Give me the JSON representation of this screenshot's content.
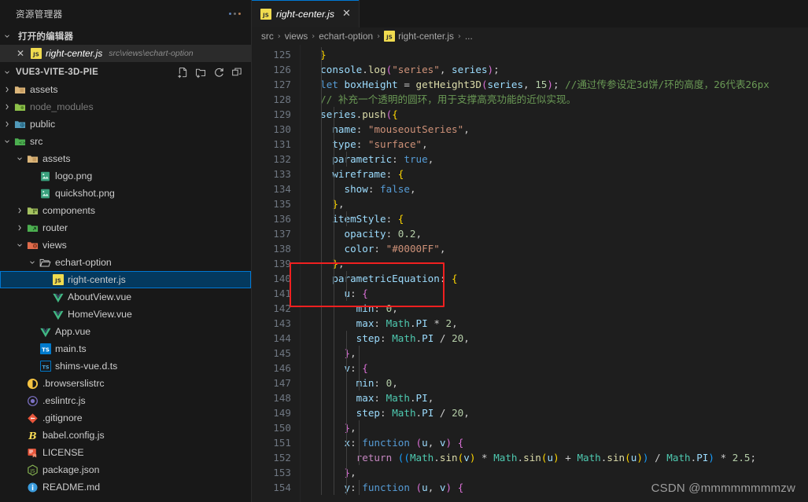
{
  "sidebar": {
    "title": "资源管理器",
    "more_icon": "more-dots-icon",
    "open_editors": {
      "label": "打开的编辑器",
      "chevron": "⌄",
      "items": [
        {
          "name": "right-center.js",
          "path": "src\\views\\echart-option",
          "icon": "js-file-icon",
          "close": "✕"
        }
      ]
    },
    "project": {
      "label": "VUE3-VITE-3D-PIE",
      "chevron": "⌄",
      "actions": [
        {
          "name": "new-file-icon",
          "title": "New File"
        },
        {
          "name": "new-folder-icon",
          "title": "New Folder"
        },
        {
          "name": "refresh-icon",
          "title": "Refresh Explorer"
        },
        {
          "name": "collapse-all-icon",
          "title": "Collapse Folders"
        }
      ]
    },
    "tree": [
      {
        "label": "assets",
        "indent": 1,
        "type": "folder",
        "chevron": "›",
        "icon": "folder-assets-icon",
        "selected": false,
        "dim": false
      },
      {
        "label": "node_modules",
        "indent": 1,
        "type": "folder",
        "chevron": "›",
        "icon": "folder-node-icon",
        "selected": false,
        "dim": true
      },
      {
        "label": "public",
        "indent": 1,
        "type": "folder",
        "chevron": "›",
        "icon": "folder-public-icon",
        "selected": false,
        "dim": false
      },
      {
        "label": "src",
        "indent": 1,
        "type": "folder",
        "chevron": "⌄",
        "icon": "folder-src-icon",
        "selected": false,
        "dim": false
      },
      {
        "label": "assets",
        "indent": 2,
        "type": "folder",
        "chevron": "⌄",
        "icon": "folder-assets-icon",
        "selected": false,
        "dim": false
      },
      {
        "label": "logo.png",
        "indent": 3,
        "type": "file",
        "chevron": "",
        "icon": "image-file-icon",
        "selected": false,
        "dim": false
      },
      {
        "label": "quickshot.png",
        "indent": 3,
        "type": "file",
        "chevron": "",
        "icon": "image-file-icon",
        "selected": false,
        "dim": false
      },
      {
        "label": "components",
        "indent": 2,
        "type": "folder",
        "chevron": "›",
        "icon": "folder-components-icon",
        "selected": false,
        "dim": false
      },
      {
        "label": "router",
        "indent": 2,
        "type": "folder",
        "chevron": "›",
        "icon": "folder-router-icon",
        "selected": false,
        "dim": false
      },
      {
        "label": "views",
        "indent": 2,
        "type": "folder",
        "chevron": "⌄",
        "icon": "folder-views-icon",
        "selected": false,
        "dim": false
      },
      {
        "label": "echart-option",
        "indent": 3,
        "type": "folder",
        "chevron": "⌄",
        "icon": "folder-open-icon",
        "selected": false,
        "dim": false
      },
      {
        "label": "right-center.js",
        "indent": 4,
        "type": "file",
        "chevron": "",
        "icon": "js-file-icon",
        "selected": true,
        "dim": false
      },
      {
        "label": "AboutView.vue",
        "indent": 4,
        "type": "file",
        "chevron": "",
        "icon": "vue-file-icon",
        "selected": false,
        "dim": false
      },
      {
        "label": "HomeView.vue",
        "indent": 4,
        "type": "file",
        "chevron": "",
        "icon": "vue-file-icon",
        "selected": false,
        "dim": false
      },
      {
        "label": "App.vue",
        "indent": 3,
        "type": "file",
        "chevron": "",
        "icon": "vue-file-icon",
        "selected": false,
        "dim": false
      },
      {
        "label": "main.ts",
        "indent": 3,
        "type": "file",
        "chevron": "",
        "icon": "ts-file-icon",
        "selected": false,
        "dim": false
      },
      {
        "label": "shims-vue.d.ts",
        "indent": 3,
        "type": "file",
        "chevron": "",
        "icon": "ts-def-file-icon",
        "selected": false,
        "dim": false
      },
      {
        "label": ".browserslistrc",
        "indent": 2,
        "type": "file",
        "chevron": "",
        "icon": "browserslist-icon",
        "selected": false,
        "dim": false
      },
      {
        "label": ".eslintrc.js",
        "indent": 2,
        "type": "file",
        "chevron": "",
        "icon": "eslint-icon",
        "selected": false,
        "dim": false
      },
      {
        "label": ".gitignore",
        "indent": 2,
        "type": "file",
        "chevron": "",
        "icon": "git-icon",
        "selected": false,
        "dim": false
      },
      {
        "label": "babel.config.js",
        "indent": 2,
        "type": "file",
        "chevron": "",
        "icon": "babel-icon",
        "selected": false,
        "dim": false
      },
      {
        "label": "LICENSE",
        "indent": 2,
        "type": "file",
        "chevron": "",
        "icon": "license-icon",
        "selected": false,
        "dim": false
      },
      {
        "label": "package.json",
        "indent": 2,
        "type": "file",
        "chevron": "",
        "icon": "npm-icon",
        "selected": false,
        "dim": false
      },
      {
        "label": "README.md",
        "indent": 2,
        "type": "file",
        "chevron": "",
        "icon": "readme-icon",
        "selected": false,
        "dim": false
      }
    ]
  },
  "editor": {
    "tab": {
      "label": "right-center.js",
      "icon": "js-file-icon",
      "close": "✕"
    },
    "breadcrumb": [
      {
        "label": "src",
        "icon": ""
      },
      {
        "label": "views",
        "icon": ""
      },
      {
        "label": "echart-option",
        "icon": ""
      },
      {
        "label": "right-center.js",
        "icon": "js-file-icon"
      },
      {
        "label": "...",
        "icon": ""
      }
    ],
    "breadcrumb_separator": "›",
    "first_line_number": 125,
    "line_count": 30,
    "watermark": "CSDN @mmmmmmmmzw",
    "highlight_box": {
      "color": "#f02020",
      "lines": [
        136,
        137,
        138
      ]
    },
    "code": [
      {
        "n": 125,
        "html": "  <span class='by'>}</span>"
      },
      {
        "n": 126,
        "html": "  <span class='v'>console</span><span class='p'>.</span><span class='f'>log</span><span class='bp'>(</span><span class='s'>\"series\"</span><span class='p'>, </span><span class='v'>series</span><span class='bp'>)</span><span class='p'>;</span>"
      },
      {
        "n": 127,
        "html": "  <span class='k'>let</span> <span class='v'>boxHeight</span> <span class='p'>=</span> <span class='f'>getHeight3D</span><span class='bp'>(</span><span class='v'>series</span><span class='p'>, </span><span class='n'>15</span><span class='bp'>)</span><span class='p'>;</span> <span class='c'>//通过传参设定3d饼/环的高度，26代表26px</span>"
      },
      {
        "n": 128,
        "html": "  <span class='c'>// 补充一个透明的圆环，用于支撑高亮功能的近似实现。</span>"
      },
      {
        "n": 129,
        "html": "  <span class='v'>series</span><span class='p'>.</span><span class='f'>push</span><span class='bp'>(</span><span class='by'>{</span>"
      },
      {
        "n": 130,
        "html": "    <span class='v'>name</span><span class='p'>:</span> <span class='s'>\"mouseoutSeries\"</span><span class='p'>,</span>"
      },
      {
        "n": 131,
        "html": "    <span class='v'>type</span><span class='p'>:</span> <span class='s'>\"surface\"</span><span class='p'>,</span>"
      },
      {
        "n": 132,
        "html": "    <span class='v'>parametric</span><span class='p'>:</span> <span class='k'>true</span><span class='p'>,</span>"
      },
      {
        "n": 133,
        "html": "    <span class='v'>wireframe</span><span class='p'>:</span> <span class='by'>{</span>"
      },
      {
        "n": 134,
        "html": "      <span class='v'>show</span><span class='p'>:</span> <span class='k'>false</span><span class='p'>,</span>"
      },
      {
        "n": 135,
        "html": "    <span class='by'>}</span><span class='p'>,</span>"
      },
      {
        "n": 136,
        "html": "    <span class='v'>itemStyle</span><span class='p'>:</span> <span class='by'>{</span>"
      },
      {
        "n": 137,
        "html": "      <span class='v'>opacity</span><span class='p'>:</span> <span class='n'>0.2</span><span class='p'>,</span>"
      },
      {
        "n": 138,
        "html": "      <span class='v'>color</span><span class='p'>:</span> <span class='s'>\"#0000FF\"</span><span class='p'>,</span>"
      },
      {
        "n": 139,
        "html": "    <span class='by'>}</span><span class='p'>,</span>"
      },
      {
        "n": 140,
        "html": "    <span class='v'>parametricEquation</span><span class='p'>:</span> <span class='by'>{</span>"
      },
      {
        "n": 141,
        "html": "      <span class='v'>u</span><span class='p'>:</span> <span class='bp'>{</span>"
      },
      {
        "n": 142,
        "html": "        <span class='v'>min</span><span class='p'>:</span> <span class='n'>0</span><span class='p'>,</span>"
      },
      {
        "n": 143,
        "html": "        <span class='v'>max</span><span class='p'>:</span> <span class='t'>Math</span><span class='p'>.</span><span class='v'>PI</span> <span class='p'>*</span> <span class='n'>2</span><span class='p'>,</span>"
      },
      {
        "n": 144,
        "html": "        <span class='v'>step</span><span class='p'>:</span> <span class='t'>Math</span><span class='p'>.</span><span class='v'>PI</span> <span class='p'>/</span> <span class='n'>20</span><span class='p'>,</span>"
      },
      {
        "n": 145,
        "html": "      <span class='bp'>}</span><span class='p'>,</span>"
      },
      {
        "n": 146,
        "html": "      <span class='v'>v</span><span class='p'>:</span> <span class='bp'>{</span>"
      },
      {
        "n": 147,
        "html": "        <span class='v'>min</span><span class='p'>:</span> <span class='n'>0</span><span class='p'>,</span>"
      },
      {
        "n": 148,
        "html": "        <span class='v'>max</span><span class='p'>:</span> <span class='t'>Math</span><span class='p'>.</span><span class='v'>PI</span><span class='p'>,</span>"
      },
      {
        "n": 149,
        "html": "        <span class='v'>step</span><span class='p'>:</span> <span class='t'>Math</span><span class='p'>.</span><span class='v'>PI</span> <span class='p'>/</span> <span class='n'>20</span><span class='p'>,</span>"
      },
      {
        "n": 150,
        "html": "      <span class='bp'>}</span><span class='p'>,</span>"
      },
      {
        "n": 151,
        "html": "      <span class='v'>x</span><span class='p'>:</span> <span class='k'>function</span> <span class='bp'>(</span><span class='v'>u</span><span class='p'>, </span><span class='v'>v</span><span class='bp'>)</span> <span class='bp'>{</span>"
      },
      {
        "n": 152,
        "html": "        <span class='kp'>return</span> <span class='bb'>((</span><span class='t'>Math</span><span class='p'>.</span><span class='f'>sin</span><span class='by'>(</span><span class='v'>v</span><span class='by'>)</span> <span class='p'>*</span> <span class='t'>Math</span><span class='p'>.</span><span class='f'>sin</span><span class='by'>(</span><span class='v'>u</span><span class='by'>)</span> <span class='p'>+</span> <span class='t'>Math</span><span class='p'>.</span><span class='f'>sin</span><span class='by'>(</span><span class='v'>u</span><span class='by'>)</span><span class='bb'>)</span> <span class='p'>/</span> <span class='t'>Math</span><span class='p'>.</span><span class='v'>PI</span><span class='bb'>)</span> <span class='p'>*</span> <span class='n'>2.5</span><span class='p'>;</span>"
      },
      {
        "n": 153,
        "html": "      <span class='bp'>}</span><span class='p'>,</span>"
      },
      {
        "n": 154,
        "html": "      <span class='v'>y</span><span class='p'>:</span> <span class='k'>function</span> <span class='bp'>(</span><span class='v'>u</span><span class='p'>, </span><span class='v'>v</span><span class='bp'>)</span> <span class='bp'>{</span>"
      }
    ]
  }
}
